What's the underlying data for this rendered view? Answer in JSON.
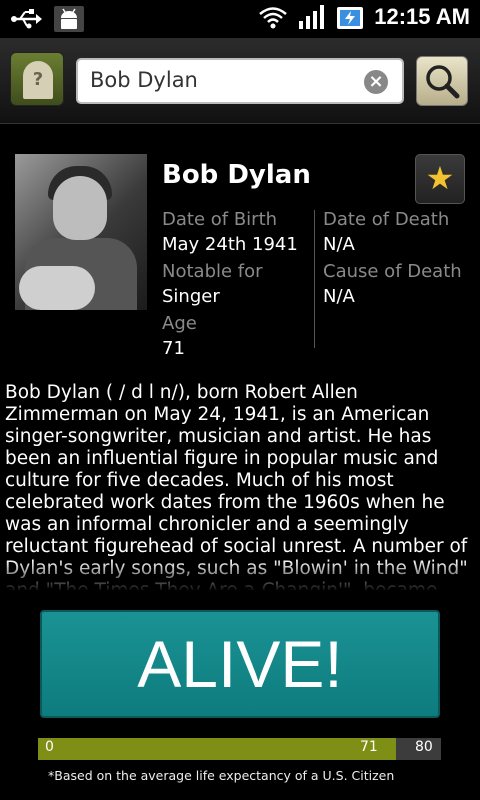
{
  "status_bar": {
    "clock": "12:15 AM",
    "icons": [
      "usb-icon",
      "android-debug-icon",
      "wifi-icon",
      "signal-icon",
      "battery-charging-icon"
    ]
  },
  "search": {
    "value": "Bob Dylan",
    "clear_icon": "clear-icon",
    "button_icon": "search-icon"
  },
  "person": {
    "name": "Bob Dylan",
    "fields": {
      "dob_label": "Date of Birth",
      "dob_value": "May 24th 1941",
      "dod_label": "Date of Death",
      "dod_value": "N/A",
      "notable_label": "Notable for",
      "notable_value": "Singer",
      "cause_label": "Cause of Death",
      "cause_value": "N/A",
      "age_label": "Age",
      "age_value": "71"
    },
    "bio": "Bob Dylan ( / d l n/), born Robert Allen Zimmerman on May 24, 1941, is an American singer-songwriter, musician and artist. He has been an influential figure in popular music and culture for five decades. Much of his most celebrated work dates from the 1960s when he was an informal chronicler and a seemingly reluctant figurehead of social unrest. A number of Dylan's early songs, such as \"Blowin' in the Wind\" and \"The Times They Are a-Changin'\", became anthems for the US civil rights and anti-war"
  },
  "status": {
    "label": "ALIVE!",
    "color": "#1a9294"
  },
  "life_bar": {
    "start_label": "0",
    "current_label": "71",
    "max_label": "80",
    "current": 71,
    "max": 80,
    "fill_color": "#7f8f16"
  },
  "footnote": "*Based on the average life expectancy of a U.S. Citizen"
}
